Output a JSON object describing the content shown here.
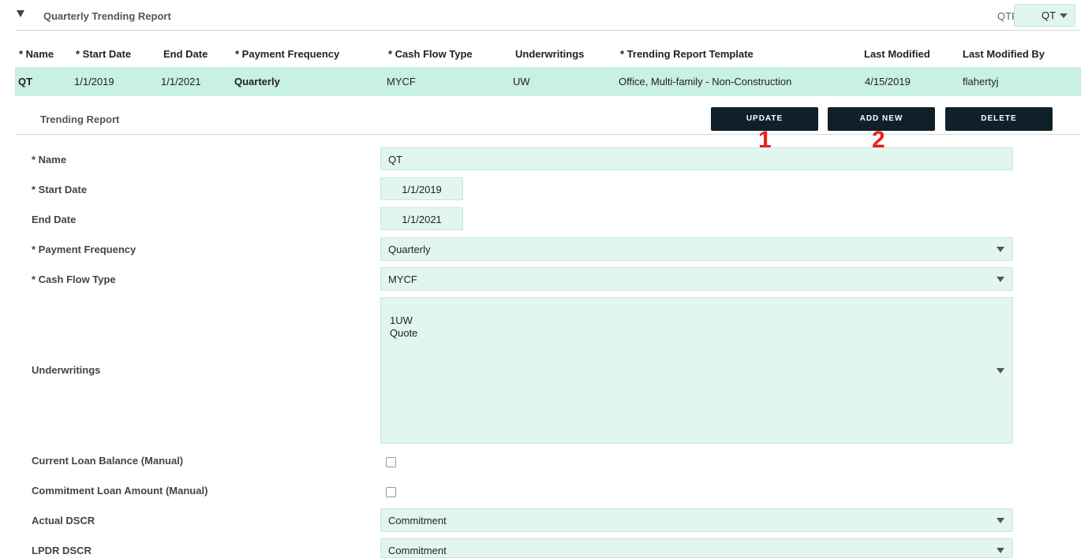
{
  "section": {
    "title": "Quarterly Trending Report",
    "qtr_label": "QTR:",
    "qtr_value": "QT"
  },
  "grid": {
    "columns": [
      "* Name",
      "* Start Date",
      "End Date",
      "* Payment Frequency",
      "* Cash Flow Type",
      "Underwritings",
      "* Trending Report Template",
      "Last Modified",
      "Last Modified By"
    ],
    "rows": [
      [
        "QT",
        "1/1/2019",
        "1/1/2021",
        "Quarterly",
        "MYCF",
        "UW",
        "Office, Multi-family - Non-Construction",
        "4/15/2019",
        "flahertyj"
      ]
    ]
  },
  "detail": {
    "title": "Trending Report",
    "buttons": {
      "update": "UPDATE",
      "add_new": "ADD NEW",
      "delete": "DELETE"
    },
    "callouts": [
      "1",
      "2"
    ]
  },
  "form": {
    "name": {
      "label": "* Name",
      "value": "QT"
    },
    "start_date": {
      "label": "* Start Date",
      "value": "1/1/2019"
    },
    "end_date": {
      "label": "End Date",
      "value": "1/1/2021"
    },
    "payment_frequency": {
      "label": "* Payment Frequency",
      "value": "Quarterly"
    },
    "cash_flow_type": {
      "label": "* Cash Flow Type",
      "value": "MYCF"
    },
    "underwritings": {
      "label": "Underwritings",
      "options": [
        "1UW",
        "Quote"
      ]
    },
    "current_loan_balance": {
      "label": "Current Loan Balance (Manual)",
      "checked": false
    },
    "commitment_loan_amount": {
      "label": "Commitment Loan Amount (Manual)",
      "checked": false
    },
    "actual_dscr": {
      "label": "Actual DSCR",
      "value": "Commitment"
    },
    "lpdr_dscr": {
      "label": "LPDR DSCR",
      "value": "Commitment"
    }
  },
  "colors": {
    "accent": "#c8f0e3",
    "field_bg": "#e2f6f0",
    "button_bg": "#10202a",
    "callout": "#e8211d"
  }
}
